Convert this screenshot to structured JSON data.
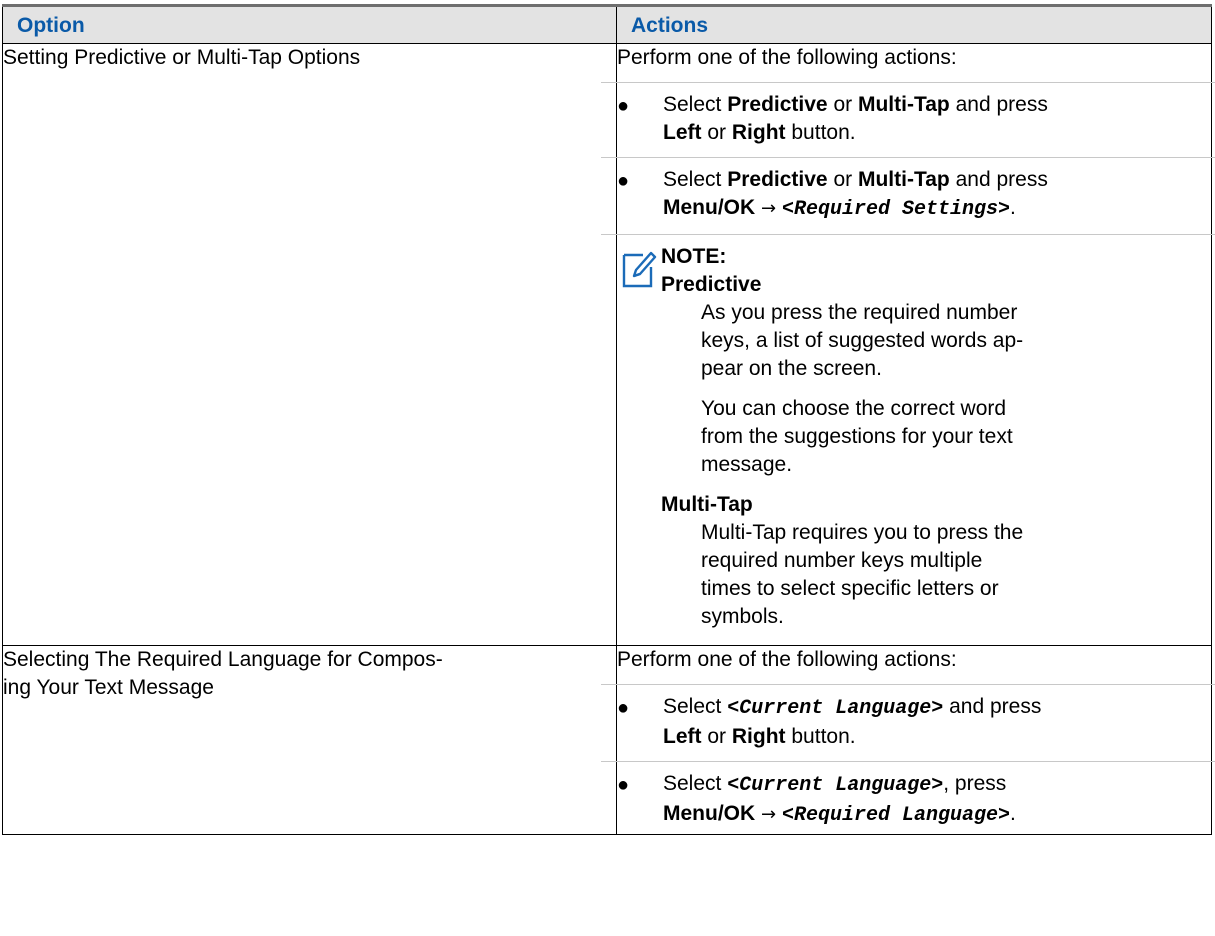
{
  "header": {
    "option": "Option",
    "actions": "Actions"
  },
  "rows": [
    {
      "option": "Setting Predictive or Multi-Tap Options",
      "intro": "Perform one of the following actions:",
      "bullet1": {
        "select": "Select",
        "a": "Predictive",
        "or": "or",
        "b": "Multi-Tap",
        "and_press": "and press",
        "left": "Left",
        "or2": "or",
        "right": "Right",
        "button": "button."
      },
      "bullet2": {
        "select": "Select",
        "a": "Predictive",
        "or": "or",
        "b": "Multi-Tap",
        "and_press": "and press",
        "menu": "Menu/OK",
        "arrow": "→",
        "setting": "<Required Settings>",
        "end": "."
      },
      "note": {
        "title": "NOTE:",
        "term1": "Predictive",
        "def1a": "As you press the required number keys, a list of suggested words ap- pear on the screen.",
        "def1b": "You can choose the correct word from the suggestions for your text message.",
        "term2": "Multi-Tap",
        "def2": "Multi-Tap requires you to press the required number keys multiple times to select specific letters or symbols."
      }
    },
    {
      "option": "Selecting The Required Language for Compos- ing Your Text Message",
      "intro": "Perform one of the following actions:",
      "bullet1": {
        "select": "Select",
        "lang": "<Current Language>",
        "and_press": "and press",
        "left": "Left",
        "or": "or",
        "right": "Right",
        "button": "button."
      },
      "bullet2": {
        "select": "Select",
        "lang": "<Current Language>",
        "comma_press": ", press",
        "menu": "Menu/OK",
        "arrow": "→",
        "req_lang": "<Required Language>",
        "end": "."
      }
    }
  ],
  "colors": {
    "header_text": "#0a5aa8",
    "header_bg": "#e3e3e3",
    "note_icon": "#1b6bb8"
  }
}
